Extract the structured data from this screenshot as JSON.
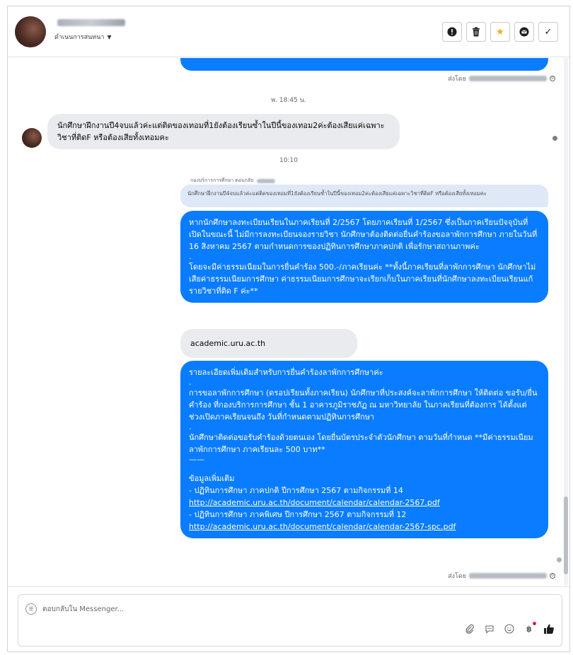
{
  "header": {
    "subtitle": "ดำเนนการสนทนา",
    "actions": [
      {
        "icon": "info-icon",
        "glyph": "!"
      },
      {
        "icon": "trash-icon",
        "glyph": "🗑"
      },
      {
        "icon": "star-icon",
        "glyph": "★"
      },
      {
        "icon": "mail-icon",
        "glyph": "✉"
      },
      {
        "icon": "check-icon",
        "glyph": "✓"
      }
    ]
  },
  "chat": {
    "sent_by_prefix": "ส่งโดย",
    "timestamp_1": "พ. 18:45 น.",
    "incoming_message": "นักศึกษาฝึกงานปี4จบแล้วค่ะแต่ติดของเทอมที่1ยังต้องเรียนซ้ำในปีนี้ของเทอม2ค่ะต้องเสียแค่เฉพาะวิชาที่ติดF หรือต้องเสียทั้งเทอมคะ",
    "timestamp_2": "10:10",
    "reply_label": "กองบริการการศึกษา ตอบกลับ",
    "quoted_text": "นักศึกษาฝึกงานปี4จบแล้วค่ะแต่ติดของเทอมที่1ยังต้องเรียนซ้ำในปีนี้ของเทอม2ค่ะต้องเสียแค่เฉพาะวิชาที่ติดF หรือต้องเสียทั้งเทอมคะ",
    "reply_1": {
      "para_1": "หากนักศึกษาลงทะเบียนเรียนในภาคเรียนที่ 2/2567 โดยภาคเรียนที่ 1/2567 ซึ่งเป็นภาคเรียนปัจจุบันที่เปิดในขณะนี้ ไม่มีการลงทะเบียนจองรายวิชา นักศึกษาต้องติดต่อยื่นคำร้องขอลาพักการศึกษา ภายในวันที่ 16 สิงหาคม 2567 ตามกำหนดการของปฏิทินการศึกษาภาคปกติ เพื่อรักษาสถานภาพค่ะ",
      "dot": ".",
      "para_2": "โดยจะมีค่าธรรมเนียมในการยื่นคำร้อง 500.-/ภาคเรียนค่ะ **ทั้งนี้ภาคเรียนที่ลาพักการศึกษา นักศึกษาไม่เสียค่าธรรมเนียมการศึกษา ค่าธรรมเนียมการศึกษาจะเรียกเก็บในภาคเรียนที่นักศึกษาลงทะเบียนเรียนแก้รายวิชาที่ติด F ค่ะ**"
    },
    "link_preview": "academic.uru.ac.th",
    "reply_2": {
      "line_1": "รายละเอียดเพิ่มเติมสำหรับการยื่นคำร้องลาพักการศึกษาค่ะ",
      "dot": ".",
      "para_1": "การขอลาพักการศึกษา (ดรอปเรียนทั้งภาคเรียน) นักศึกษาที่ประสงค์จะลาพักการศึกษา ให้ติดต่อ ขอรับ/ยื่นคำร้อง ที่กองบริการการศึกษา ชั้น 1 อาคารภูมิราชภัฏ ณ มหาวิทยาลัย ในภาคเรียนที่ต้องการ ได้ตั้งแต่ช่วงเปิดภาคเรียนจนถึง วันที่กำหนดตามปฏิทินการศึกษา",
      "para_2": "นักศึกษาติดต่อขอรับคำร้องด้วยตนเอง โดยยื่นบัตรประจำตัวนักศึกษา ตามวันที่กำหนด **มีค่าธรรมเนียมลาพักการศึกษา ภาคเรียนละ 500 บาท**",
      "divider": "——",
      "more_info": "ข้อมูลเพิ่มเติม",
      "item_1": "- ปฏิทินการศึกษา ภาคปกติ ปีการศึกษา 2567 ตามกิจกรรมที่ 14",
      "link_1": "http://academic.uru.ac.th/document/calendar/calendar-2567.pdf",
      "item_2": "- ปฏิทินการศึกษา ภาคพิเศษ ปีการศึกษา 2567 ตามกิจกรรมที่ 12",
      "link_2": "http://academic.uru.ac.th/document/calendar/calendar-2567-spc.pdf"
    }
  },
  "composer": {
    "placeholder": "ตอบกลับใน Messenger..."
  },
  "colors": {
    "outgoing_bubble": "#0a7cff",
    "incoming_bubble": "#e9ebee",
    "accent_star": "#f5a623"
  }
}
